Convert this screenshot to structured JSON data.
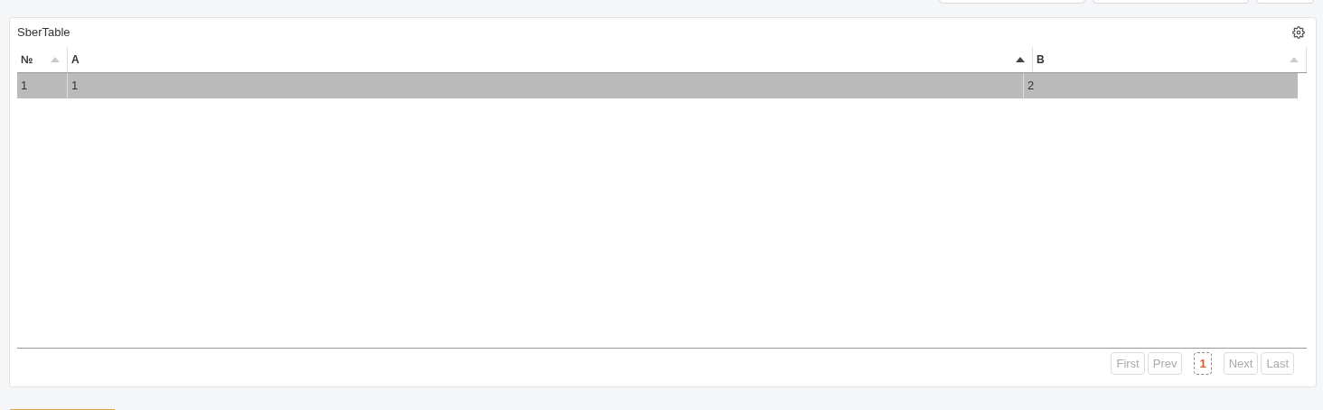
{
  "panel": {
    "title": "SberTable"
  },
  "table": {
    "columns": [
      {
        "label": "№",
        "sorted": false
      },
      {
        "label": "A",
        "sorted": true
      },
      {
        "label": "B",
        "sorted": false
      }
    ],
    "rows": [
      {
        "cells": [
          "1",
          "1",
          "2"
        ],
        "selected": true
      }
    ]
  },
  "pagination": [
    {
      "label": "First",
      "kind": "nav",
      "disabled": true
    },
    {
      "label": "Prev",
      "kind": "nav",
      "disabled": true
    },
    {
      "label": "1",
      "kind": "page",
      "selected": true
    },
    {
      "label": "Next",
      "kind": "nav",
      "disabled": true
    },
    {
      "label": "Last",
      "kind": "nav",
      "disabled": true
    }
  ]
}
